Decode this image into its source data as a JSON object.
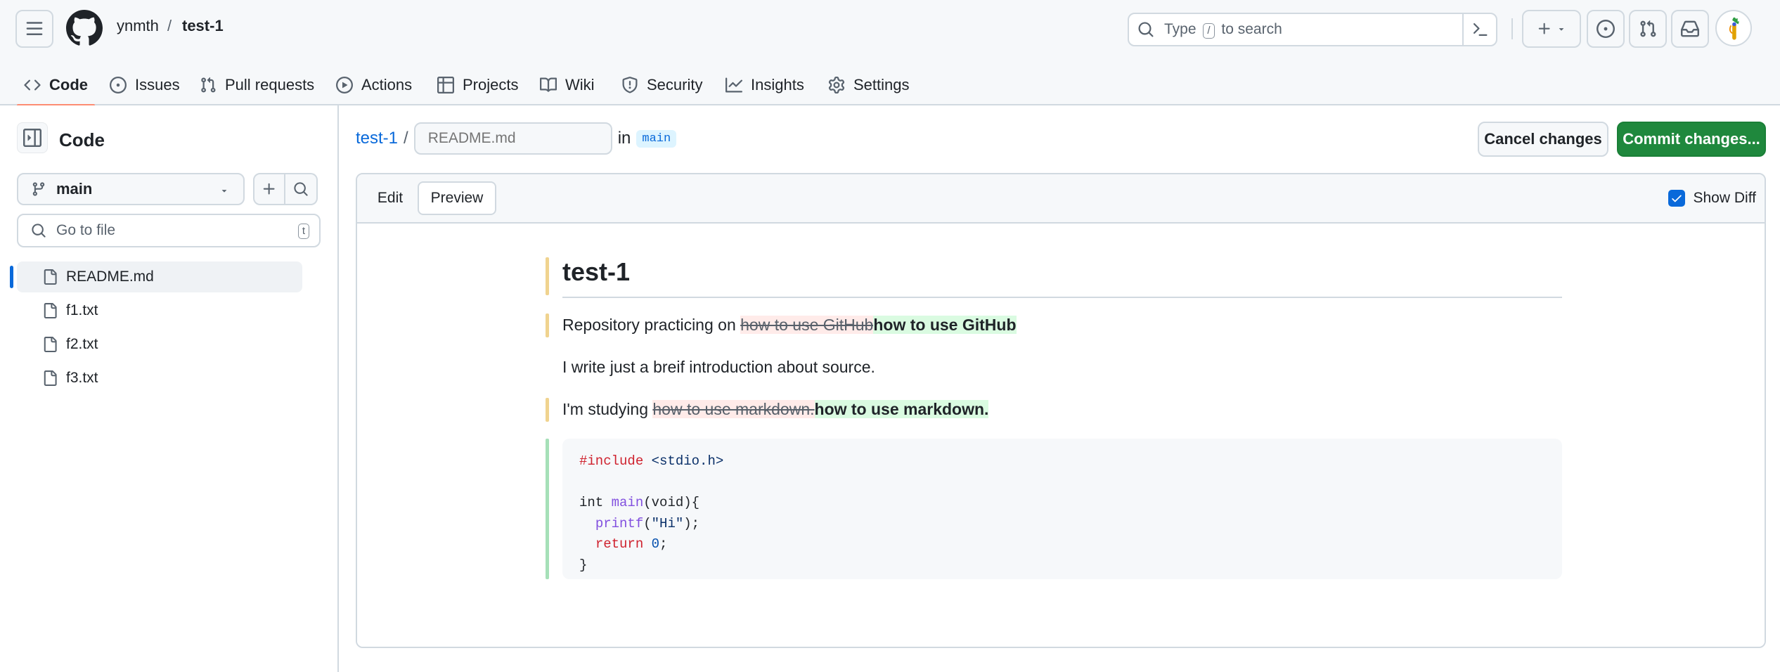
{
  "header": {
    "owner": "ynmth",
    "separator": "/",
    "repo": "test-1",
    "search_prefix": "Type",
    "search_key": "/",
    "search_suffix": "to search"
  },
  "nav_tabs": [
    {
      "label": "Code",
      "icon": "code-icon",
      "active": true
    },
    {
      "label": "Issues",
      "icon": "issue-icon"
    },
    {
      "label": "Pull requests",
      "icon": "pull-request-icon"
    },
    {
      "label": "Actions",
      "icon": "play-icon"
    },
    {
      "label": "Projects",
      "icon": "table-icon"
    },
    {
      "label": "Wiki",
      "icon": "book-icon"
    },
    {
      "label": "Security",
      "icon": "shield-icon"
    },
    {
      "label": "Insights",
      "icon": "graph-icon"
    },
    {
      "label": "Settings",
      "icon": "gear-icon"
    }
  ],
  "sidebar": {
    "title": "Code",
    "branch": "main",
    "goto_placeholder": "Go to file",
    "goto_key": "t",
    "files": [
      "README.md",
      "f1.txt",
      "f2.txt",
      "f3.txt"
    ],
    "selected_file": "README.md"
  },
  "editor": {
    "repo_link": "test-1",
    "path_sep": "/",
    "filename": "README.md",
    "in_label": "in",
    "branch": "main",
    "cancel_label": "Cancel changes",
    "commit_label": "Commit changes...",
    "tab_edit": "Edit",
    "tab_preview": "Preview",
    "show_diff_label": "Show Diff",
    "show_diff_checked": true
  },
  "preview": {
    "heading": "test-1",
    "line1_prefix": "Repository practicing on ",
    "line1_deleted": "how to use GitHub",
    "line1_added": "how to use GitHub",
    "line2": "I write just a breif introduction about source.",
    "line3_prefix": "I'm studying ",
    "line3_deleted": "how to use markdown.",
    "line3_added": "how to use markdown.",
    "code": {
      "include_kw": "#include",
      "include_hdr": "<stdio.h>",
      "main_type": "int",
      "main_fn": "main",
      "main_args": "(void){",
      "printf_fn": "printf",
      "printf_open": "(",
      "printf_str": "\"Hi\"",
      "printf_close": ");",
      "return_kw": "return",
      "return_val": "0",
      "return_end": ";",
      "close_brace": "}"
    }
  },
  "colors": {
    "accent": "#0969da",
    "commit_green": "#1f883d",
    "tab_underline": "#fd8c73",
    "diff_added_bg": "#dafbe1",
    "diff_deleted_bg": "#ffebe9"
  }
}
